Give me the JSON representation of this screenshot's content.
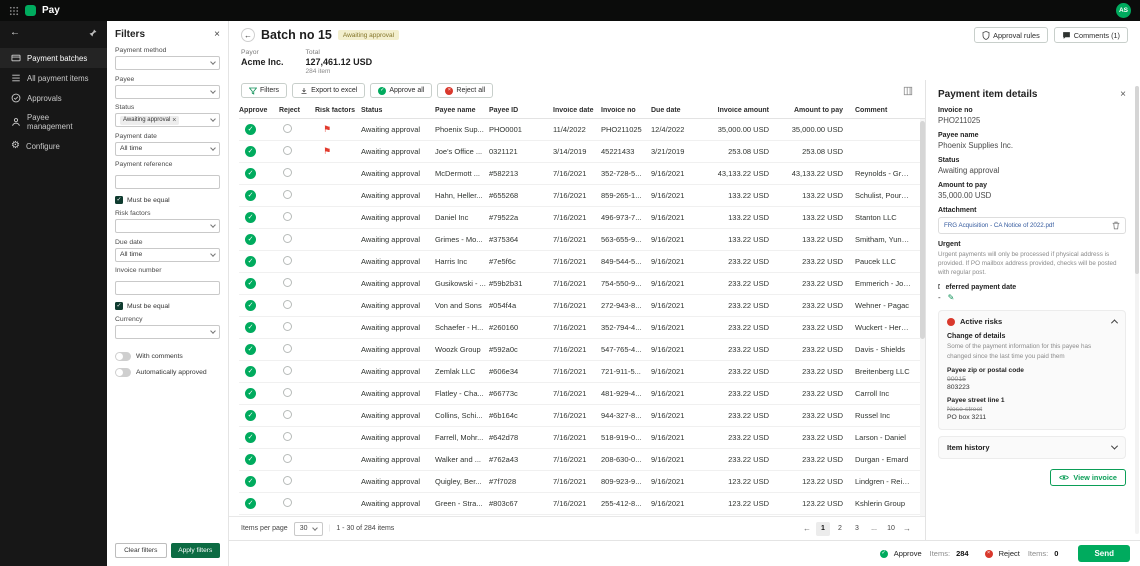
{
  "topbar": {
    "app_name": "Pay",
    "avatar": "AS"
  },
  "sidebar": {
    "items": [
      {
        "label": "Payment batches",
        "icon": "card-icon"
      },
      {
        "label": "All payment items",
        "icon": "list-icon"
      },
      {
        "label": "Approvals",
        "icon": "check-circle-icon"
      },
      {
        "label": "Payee management",
        "icon": "person-icon"
      },
      {
        "label": "Configure",
        "icon": "gear-icon"
      }
    ]
  },
  "filters": {
    "title": "Filters",
    "payment_method_label": "Payment method",
    "payee_label": "Payee",
    "status_label": "Status",
    "status_chip": "Awaiting approval",
    "payment_date_label": "Payment date",
    "payment_date_value": "All time",
    "payment_reference_label": "Payment reference",
    "must_be_equal_1": "Must be equal",
    "risk_factors_label": "Risk factors",
    "due_date_label": "Due date",
    "due_date_value": "All time",
    "invoice_number_label": "Invoice number",
    "must_be_equal_2": "Must be equal",
    "currency_label": "Currency",
    "with_comments_label": "With comments",
    "automatically_approved_label": "Automatically approved",
    "clear_button": "Clear filters",
    "apply_button": "Apply filters"
  },
  "header": {
    "title": "Batch no 15",
    "status_badge": "Awaiting approval",
    "approval_rules_button": "Approval rules",
    "comments_button": "Comments (1)",
    "payor_label": "Payor",
    "payor_value": "Acme Inc.",
    "total_label": "Total",
    "total_value": "127,461.12 USD",
    "total_items": "284 item"
  },
  "toolbar": {
    "filters_button": "Filters",
    "export_button": "Export to excel",
    "approve_all_button": "Approve all",
    "reject_all_button": "Reject all"
  },
  "table": {
    "columns": [
      "Approve",
      "Reject",
      "Risk factors",
      "Status",
      "Payee name",
      "Payee ID",
      "Invoice date",
      "Invoice no",
      "Due date",
      "Invoice amount",
      "Amount to pay",
      "Comment"
    ],
    "rows": [
      {
        "risk": true,
        "status": "Awaiting approval",
        "payee_name": "Phoenix Sup...",
        "payee_id": "PHO0001",
        "invoice_date": "11/4/2022",
        "invoice_no": "PHO211025",
        "due_date": "12/4/2022",
        "invoice_amount": "35,000.00 USD",
        "amount_to_pay": "35,000.00 USD",
        "comment": ""
      },
      {
        "risk": true,
        "status": "Awaiting approval",
        "payee_name": "Joe's Office ...",
        "payee_id": "0321121",
        "invoice_date": "3/14/2019",
        "invoice_no": "45221433",
        "due_date": "3/21/2019",
        "invoice_amount": "253.08 USD",
        "amount_to_pay": "253.08 USD",
        "comment": ""
      },
      {
        "risk": false,
        "status": "Awaiting approval",
        "payee_name": "McDermott ...",
        "payee_id": "#582213",
        "invoice_date": "7/16/2021",
        "invoice_no": "352-728-5...",
        "due_date": "9/16/2021",
        "invoice_amount": "43,133.22 USD",
        "amount_to_pay": "43,133.22 USD",
        "comment": "Reynolds - Graham"
      },
      {
        "risk": false,
        "status": "Awaiting approval",
        "payee_name": "Hahn, Heller...",
        "payee_id": "#655268",
        "invoice_date": "7/16/2021",
        "invoice_no": "859-265-1...",
        "due_date": "9/16/2021",
        "invoice_amount": "133.22 USD",
        "amount_to_pay": "133.22 USD",
        "comment": "Schulist, Pouros and Wy..."
      },
      {
        "risk": false,
        "status": "Awaiting approval",
        "payee_name": "Daniel Inc",
        "payee_id": "#79522a",
        "invoice_date": "7/16/2021",
        "invoice_no": "496-973-7...",
        "due_date": "9/16/2021",
        "invoice_amount": "133.22 USD",
        "amount_to_pay": "133.22 USD",
        "comment": "Stanton LLC"
      },
      {
        "risk": false,
        "status": "Awaiting approval",
        "payee_name": "Grimes - Mo...",
        "payee_id": "#375364",
        "invoice_date": "7/16/2021",
        "invoice_no": "563-655-9...",
        "due_date": "9/16/2021",
        "invoice_amount": "133.22 USD",
        "amount_to_pay": "133.22 USD",
        "comment": "Smitham, Yundt and Wat..."
      },
      {
        "risk": false,
        "status": "Awaiting approval",
        "payee_name": "Harris Inc",
        "payee_id": "#7e5f6c",
        "invoice_date": "7/16/2021",
        "invoice_no": "849-544-5...",
        "due_date": "9/16/2021",
        "invoice_amount": "233.22 USD",
        "amount_to_pay": "233.22 USD",
        "comment": "Paucek LLC"
      },
      {
        "risk": false,
        "status": "Awaiting approval",
        "payee_name": "Gusikowski - ...",
        "payee_id": "#59b2b31",
        "invoice_date": "7/16/2021",
        "invoice_no": "754-550-9...",
        "due_date": "9/16/2021",
        "invoice_amount": "233.22 USD",
        "amount_to_pay": "233.22 USD",
        "comment": "Emmerich - Johnston"
      },
      {
        "risk": false,
        "status": "Awaiting approval",
        "payee_name": "Von and Sons",
        "payee_id": "#054f4a",
        "invoice_date": "7/16/2021",
        "invoice_no": "272-943-8...",
        "due_date": "9/16/2021",
        "invoice_amount": "233.22 USD",
        "amount_to_pay": "233.22 USD",
        "comment": "Wehner - Pagac"
      },
      {
        "risk": false,
        "status": "Awaiting approval",
        "payee_name": "Schaefer - H...",
        "payee_id": "#260160",
        "invoice_date": "7/16/2021",
        "invoice_no": "352-794-4...",
        "due_date": "9/16/2021",
        "invoice_amount": "233.22 USD",
        "amount_to_pay": "233.22 USD",
        "comment": "Wuckert - Hermiston"
      },
      {
        "risk": false,
        "status": "Awaiting approval",
        "payee_name": "Woozk Group",
        "payee_id": "#592a0c",
        "invoice_date": "7/16/2021",
        "invoice_no": "547-765-4...",
        "due_date": "9/16/2021",
        "invoice_amount": "233.22 USD",
        "amount_to_pay": "233.22 USD",
        "comment": "Davis - Shields"
      },
      {
        "risk": false,
        "status": "Awaiting approval",
        "payee_name": "Zemlak LLC",
        "payee_id": "#606e34",
        "invoice_date": "7/16/2021",
        "invoice_no": "721-911-5...",
        "due_date": "9/16/2021",
        "invoice_amount": "233.22 USD",
        "amount_to_pay": "233.22 USD",
        "comment": "Breitenberg LLC"
      },
      {
        "risk": false,
        "status": "Awaiting approval",
        "payee_name": "Flatley - Cha...",
        "payee_id": "#66773c",
        "invoice_date": "7/16/2021",
        "invoice_no": "481-929-4...",
        "due_date": "9/16/2021",
        "invoice_amount": "233.22 USD",
        "amount_to_pay": "233.22 USD",
        "comment": "Carroll Inc"
      },
      {
        "risk": false,
        "status": "Awaiting approval",
        "payee_name": "Collins, Schi...",
        "payee_id": "#6b164c",
        "invoice_date": "7/16/2021",
        "invoice_no": "944-327-8...",
        "due_date": "9/16/2021",
        "invoice_amount": "233.22 USD",
        "amount_to_pay": "233.22 USD",
        "comment": "Russel Inc"
      },
      {
        "risk": false,
        "status": "Awaiting approval",
        "payee_name": "Farrell, Mohr...",
        "payee_id": "#642d78",
        "invoice_date": "7/16/2021",
        "invoice_no": "518-919-0...",
        "due_date": "9/16/2021",
        "invoice_amount": "233.22 USD",
        "amount_to_pay": "233.22 USD",
        "comment": "Larson - Daniel"
      },
      {
        "risk": false,
        "status": "Awaiting approval",
        "payee_name": "Walker and ...",
        "payee_id": "#762a43",
        "invoice_date": "7/16/2021",
        "invoice_no": "208-630-0...",
        "due_date": "9/16/2021",
        "invoice_amount": "233.22 USD",
        "amount_to_pay": "233.22 USD",
        "comment": "Durgan - Emard"
      },
      {
        "risk": false,
        "status": "Awaiting approval",
        "payee_name": "Quigley, Ber...",
        "payee_id": "#7f7028",
        "invoice_date": "7/16/2021",
        "invoice_no": "809-923-9...",
        "due_date": "9/16/2021",
        "invoice_amount": "123.22 USD",
        "amount_to_pay": "123.22 USD",
        "comment": "Lindgren - Reichel"
      },
      {
        "risk": false,
        "status": "Awaiting approval",
        "payee_name": "Green - Stra...",
        "payee_id": "#803c67",
        "invoice_date": "7/16/2021",
        "invoice_no": "255-412-8...",
        "due_date": "9/16/2021",
        "invoice_amount": "123.22 USD",
        "amount_to_pay": "123.22 USD",
        "comment": "Kshlerin Group"
      }
    ]
  },
  "pagination": {
    "items_per_page_label": "Items per page",
    "items_per_page": "30",
    "range": "1 - 30 of 284 items",
    "pages": [
      "1",
      "2",
      "3",
      "...",
      "10"
    ]
  },
  "footer": {
    "approve_label": "Approve",
    "approve_items_label": "Items:",
    "approve_count": "284",
    "reject_label": "Reject",
    "reject_items_label": "Items:",
    "reject_count": "0",
    "send_button": "Send"
  },
  "details": {
    "title": "Payment item details",
    "invoice_no_label": "Invoice no",
    "invoice_no": "PHO211025",
    "payee_name_label": "Payee name",
    "payee_name": "Phoenix Supplies Inc.",
    "status_label": "Status",
    "status": "Awaiting approval",
    "amount_label": "Amount to pay",
    "amount": "35,000.00 USD",
    "attachment_label": "Attachment",
    "attachment_name": "FRG Acquisition - CA Notice of 2022.pdf",
    "urgent_label": "Urgent",
    "urgent_description": "Urgent payments will only be processed if physical address is provided. If PO mailbox address provided, checks will be posted with regular post.",
    "preferred_date_label": "Preferred payment date",
    "preferred_date_value": "-",
    "active_risks": {
      "title": "Active risks",
      "change_title": "Change of details",
      "change_description": "Some of the payment information for this payee has changed since the last time you paid them",
      "zip_label": "Payee zip or postal code",
      "zip_old": "90015",
      "zip_new": "803223",
      "street_label": "Payee street line 1",
      "street_old": "Nose-street",
      "street_new": "PO box 3211"
    },
    "item_history_label": "Item history",
    "view_invoice_button": "View invoice"
  }
}
